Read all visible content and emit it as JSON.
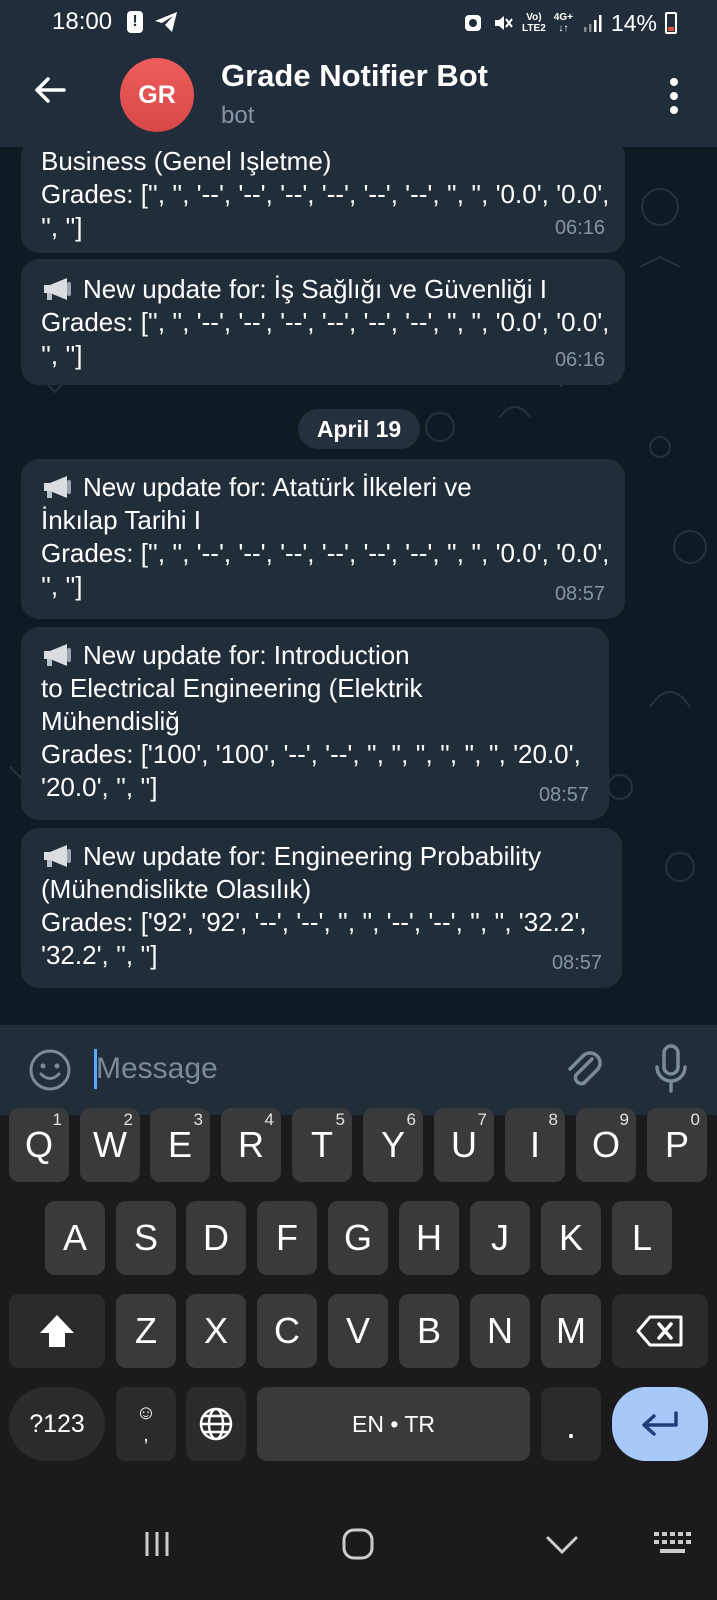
{
  "status_bar": {
    "time": "18:00",
    "network_top": "Vo)",
    "network_bottom": "LTE2",
    "data_type": "4G+",
    "battery": "14%"
  },
  "header": {
    "avatar_initials": "GR",
    "title": "Grade Notifier Bot",
    "subtitle": "bot"
  },
  "messages": [
    {
      "lines": [
        "Business (Genel Işletme)",
        "Grades: ['', '', '--', '--', '--', '--', '--', '--', '', '', '0.0', '0.0',",
        "'', '']"
      ],
      "time": "06:16"
    },
    {
      "lines": [
        "New update for: İş Sağlığı ve Güvenliği I",
        "Grades: ['', '', '--', '--', '--', '--', '--', '--', '', '', '0.0', '0.0',",
        "'', '']"
      ],
      "time": "06:16"
    },
    {
      "lines": [
        "New update for: Atatürk İlkeleri ve",
        "İnkılap Tarihi I",
        "Grades: ['', '', '--', '--', '--', '--', '--', '--', '', '', '0.0', '0.0',",
        "'', '']"
      ],
      "time": "08:57"
    },
    {
      "lines": [
        "New update for: Introduction",
        "to Electrical Engineering (Elektrik",
        "Mühendisliğ",
        "Grades: ['100', '100', '--', '--', '', '', '', '', '', '', '20.0',",
        "'20.0', '', '']"
      ],
      "time": "08:57"
    },
    {
      "lines": [
        "New update for: Engineering Probability",
        "(Mühendislikte Olasılık)",
        "Grades: ['92', '92', '--', '--', '', '', '--', '--', '', '', '32.2',",
        "'32.2', '', '']"
      ],
      "time": "08:57"
    }
  ],
  "date_separator": "April 19",
  "composer": {
    "placeholder": "Message"
  },
  "keyboard": {
    "row1": [
      {
        "key": "Q",
        "hint": "1"
      },
      {
        "key": "W",
        "hint": "2"
      },
      {
        "key": "E",
        "hint": "3"
      },
      {
        "key": "R",
        "hint": "4"
      },
      {
        "key": "T",
        "hint": "5"
      },
      {
        "key": "Y",
        "hint": "6"
      },
      {
        "key": "U",
        "hint": "7"
      },
      {
        "key": "I",
        "hint": "8"
      },
      {
        "key": "O",
        "hint": "9"
      },
      {
        "key": "P",
        "hint": "0"
      }
    ],
    "row2": [
      "A",
      "S",
      "D",
      "F",
      "G",
      "H",
      "J",
      "K",
      "L"
    ],
    "row3": [
      "Z",
      "X",
      "C",
      "V",
      "B",
      "N",
      "M"
    ],
    "symbols_label": "?123",
    "emoji_label": "☺",
    "comma_label": ",",
    "space_label": "EN • TR",
    "period_label": "."
  },
  "icons": {
    "back": "arrow-left-icon",
    "menu": "more-vertical-icon",
    "emoji": "smiley-icon",
    "attach": "paperclip-icon",
    "mic": "microphone-icon",
    "megaphone": "megaphone-icon"
  },
  "colors": {
    "header_bg": "#212d3b",
    "chat_bg": "#0f1a23",
    "bubble_bg": "#222d3a",
    "accent": "#5aa8ff",
    "avatar": "#e05252",
    "enter_key": "#a8c8fa"
  }
}
